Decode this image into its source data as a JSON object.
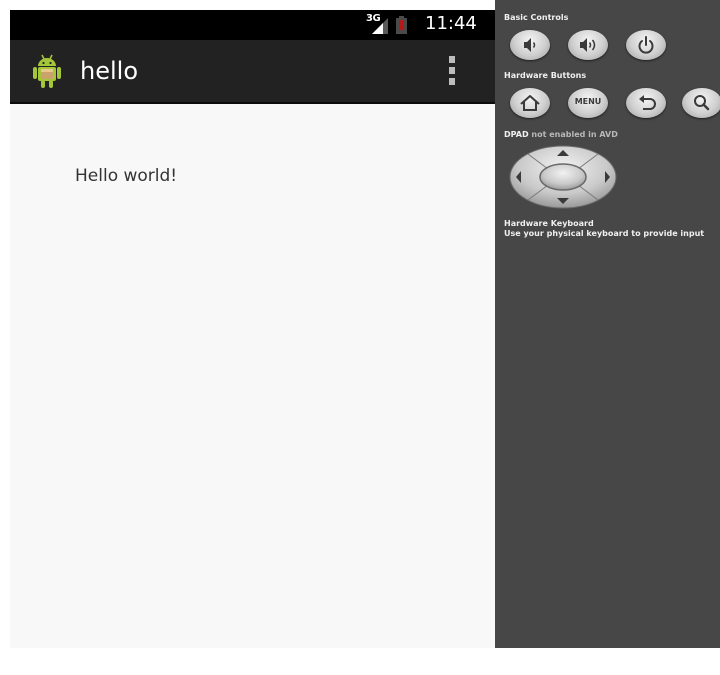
{
  "status_bar": {
    "network": "3G",
    "time": "11:44",
    "signal_icon": "signal-bars-icon",
    "battery_icon": "battery-low-icon"
  },
  "action_bar": {
    "title": "hello",
    "app_icon": "android-robot-icon",
    "overflow_icon": "overflow-menu-icon"
  },
  "content": {
    "text": "Hello world!"
  },
  "controls": {
    "basic_controls_label": "Basic Controls",
    "basic_buttons": [
      "volume-down-icon",
      "volume-up-icon",
      "power-icon"
    ],
    "hardware_buttons_label": "Hardware Buttons",
    "hardware_buttons": [
      "home-icon",
      "menu-button",
      "back-icon",
      "search-icon"
    ],
    "menu_label": "MENU",
    "dpad_label": "DPAD",
    "dpad_note": "not enabled in AVD",
    "keyboard_label": "Hardware Keyboard",
    "keyboard_note": "Use your physical keyboard to provide input"
  },
  "colors": {
    "status_bar": "#000000",
    "action_bar": "#222222",
    "content_bg": "#f8f8f8",
    "panel_bg": "#474747",
    "android_green": "#a4c639"
  }
}
